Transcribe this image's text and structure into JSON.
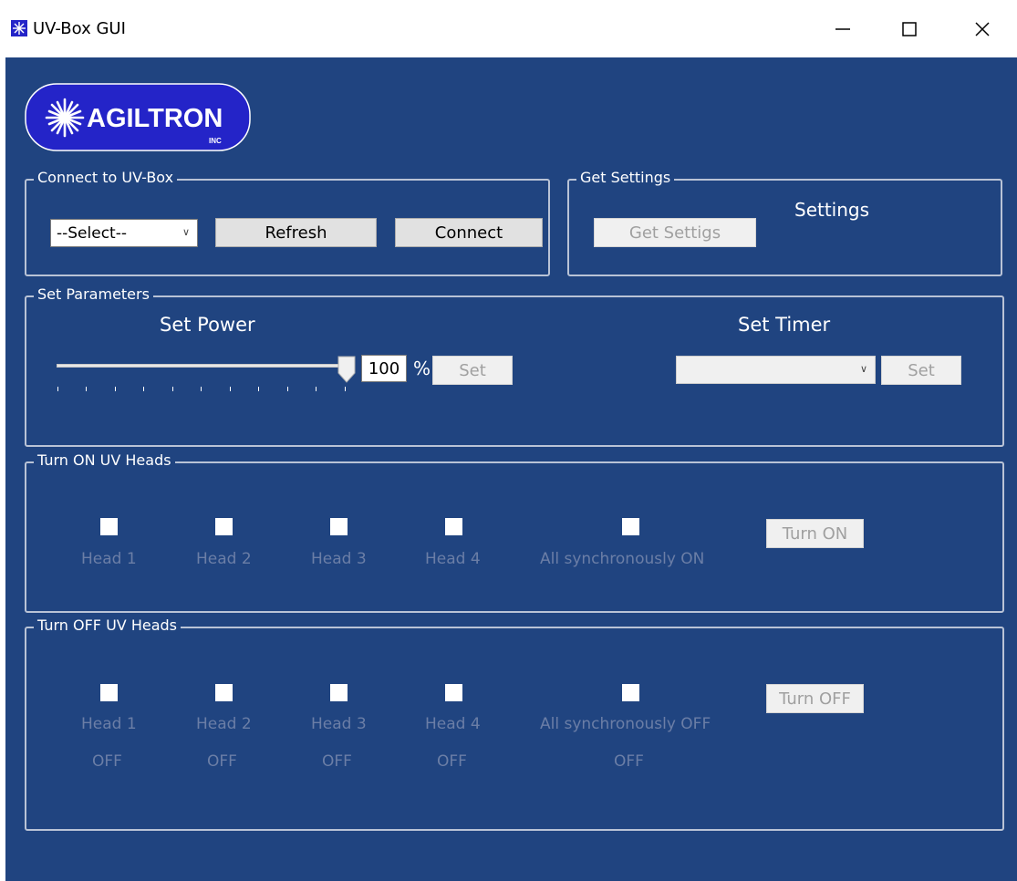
{
  "window": {
    "title": "UV-Box GUI",
    "controls": {
      "minimize": "minimize",
      "maximize": "maximize",
      "close": "close"
    }
  },
  "logo": {
    "text": "AGILTRON",
    "sub": "INC"
  },
  "connect": {
    "legend": "Connect to UV-Box",
    "port_select": "--Select--",
    "refresh_label": "Refresh",
    "connect_label": "Connect"
  },
  "settings": {
    "legend": "Get Settings",
    "get_label": "Get Settigs",
    "settings_text": "Settings"
  },
  "parameters": {
    "legend": "Set Parameters",
    "power_title": "Set Power",
    "power_value": "100",
    "power_unit": "%",
    "power_fraction": 1.0,
    "power_set_label": "Set",
    "timer_title": "Set Timer",
    "timer_value": "",
    "timer_set_label": "Set"
  },
  "turn_on": {
    "legend": "Turn ON UV Heads",
    "heads": [
      "Head 1",
      "Head 2",
      "Head 3",
      "Head 4"
    ],
    "all_label": "All synchronously ON",
    "button_label": "Turn ON"
  },
  "turn_off": {
    "legend": "Turn OFF UV Heads",
    "heads": [
      "Head 1",
      "Head 2",
      "Head 3",
      "Head 4"
    ],
    "all_label": "All synchronously OFF",
    "status": [
      "OFF",
      "OFF",
      "OFF",
      "OFF"
    ],
    "all_status": "OFF",
    "button_label": "Turn OFF"
  },
  "colors": {
    "background": "#204480",
    "dim_text": "#6b7ea6",
    "group_border": "#b9c3d6",
    "logo_blue": "#2424c8"
  }
}
